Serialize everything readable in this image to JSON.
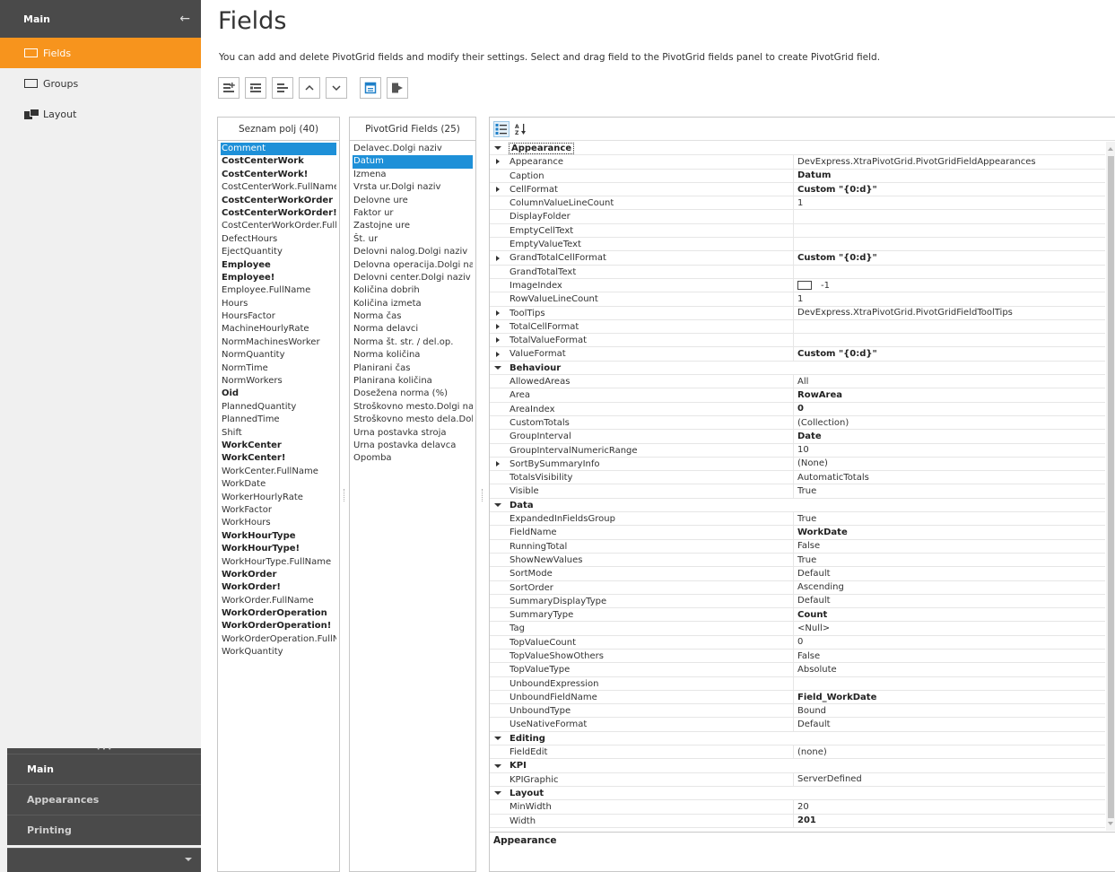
{
  "sidebar": {
    "header": "Main",
    "items": [
      {
        "label": "Fields",
        "active": true
      },
      {
        "label": "Groups",
        "active": false
      },
      {
        "label": "Layout",
        "active": false
      }
    ],
    "groups": [
      "Main",
      "Appearances",
      "Printing"
    ]
  },
  "page": {
    "title": "Fields",
    "description": "You can add and delete PivotGrid fields and modify their settings. Select and drag field to the PivotGrid fields panel to create PivotGrid field."
  },
  "field_list": {
    "header": "Seznam polj (40)",
    "items": [
      {
        "text": "Comment",
        "bold": false,
        "selected": true
      },
      {
        "text": "CostCenterWork",
        "bold": true
      },
      {
        "text": "CostCenterWork!",
        "bold": true
      },
      {
        "text": "CostCenterWork.FullName",
        "bold": false
      },
      {
        "text": "CostCenterWorkOrder",
        "bold": true
      },
      {
        "text": "CostCenterWorkOrder!",
        "bold": true
      },
      {
        "text": "CostCenterWorkOrder.FullNa",
        "bold": false
      },
      {
        "text": "DefectHours",
        "bold": false
      },
      {
        "text": "EjectQuantity",
        "bold": false
      },
      {
        "text": "Employee",
        "bold": true
      },
      {
        "text": "Employee!",
        "bold": true
      },
      {
        "text": "Employee.FullName",
        "bold": false
      },
      {
        "text": "Hours",
        "bold": false
      },
      {
        "text": "HoursFactor",
        "bold": false
      },
      {
        "text": "MachineHourlyRate",
        "bold": false
      },
      {
        "text": "NormMachinesWorker",
        "bold": false
      },
      {
        "text": "NormQuantity",
        "bold": false
      },
      {
        "text": "NormTime",
        "bold": false
      },
      {
        "text": "NormWorkers",
        "bold": false
      },
      {
        "text": "Oid",
        "bold": true
      },
      {
        "text": "PlannedQuantity",
        "bold": false
      },
      {
        "text": "PlannedTime",
        "bold": false
      },
      {
        "text": "Shift",
        "bold": false
      },
      {
        "text": "WorkCenter",
        "bold": true
      },
      {
        "text": "WorkCenter!",
        "bold": true
      },
      {
        "text": "WorkCenter.FullName",
        "bold": false
      },
      {
        "text": "WorkDate",
        "bold": false
      },
      {
        "text": "WorkerHourlyRate",
        "bold": false
      },
      {
        "text": "WorkFactor",
        "bold": false
      },
      {
        "text": "WorkHours",
        "bold": false
      },
      {
        "text": "WorkHourType",
        "bold": true
      },
      {
        "text": "WorkHourType!",
        "bold": true
      },
      {
        "text": "WorkHourType.FullName",
        "bold": false
      },
      {
        "text": "WorkOrder",
        "bold": true
      },
      {
        "text": "WorkOrder!",
        "bold": true
      },
      {
        "text": "WorkOrder.FullName",
        "bold": false
      },
      {
        "text": "WorkOrderOperation",
        "bold": true
      },
      {
        "text": "WorkOrderOperation!",
        "bold": true
      },
      {
        "text": "WorkOrderOperation.FullNam",
        "bold": false
      },
      {
        "text": "WorkQuantity",
        "bold": false
      }
    ]
  },
  "pivot_fields": {
    "header": "PivotGrid Fields (25)",
    "items": [
      {
        "text": "Delavec.Dolgi naziv",
        "selected": false
      },
      {
        "text": "Datum",
        "selected": true
      },
      {
        "text": "Izmena"
      },
      {
        "text": "Vrsta ur.Dolgi naziv"
      },
      {
        "text": "Delovne ure"
      },
      {
        "text": "Faktor ur"
      },
      {
        "text": "Zastojne ure"
      },
      {
        "text": "Št. ur"
      },
      {
        "text": "Delovni nalog.Dolgi naziv"
      },
      {
        "text": "Delovna operacija.Dolgi naziv"
      },
      {
        "text": "Delovni center.Dolgi naziv"
      },
      {
        "text": "Količina dobrih"
      },
      {
        "text": "Količina izmeta"
      },
      {
        "text": "Norma čas"
      },
      {
        "text": "Norma delavci"
      },
      {
        "text": "Norma št. str. / del.op."
      },
      {
        "text": "Norma količina"
      },
      {
        "text": "Planirani čas"
      },
      {
        "text": "Planirana količina"
      },
      {
        "text": "Dosežena norma (%)"
      },
      {
        "text": "Stroškovno mesto.Dolgi naziv"
      },
      {
        "text": "Stroškovno mesto dela.Dolgi na"
      },
      {
        "text": "Urna postavka stroja"
      },
      {
        "text": "Urna postavka delavca"
      },
      {
        "text": "Opomba"
      }
    ]
  },
  "property_grid": {
    "rows": [
      {
        "type": "cat",
        "name": "Appearance",
        "focused": true
      },
      {
        "name": "Appearance",
        "value": "DevExpress.XtraPivotGrid.PivotGridFieldAppearances",
        "expand": true
      },
      {
        "name": "Caption",
        "value": "Datum",
        "bold": true
      },
      {
        "name": "CellFormat",
        "value": "Custom \"{0:d}\"",
        "bold": true,
        "expand": true
      },
      {
        "name": "ColumnValueLineCount",
        "value": "1"
      },
      {
        "name": "DisplayFolder",
        "value": ""
      },
      {
        "name": "EmptyCellText",
        "value": ""
      },
      {
        "name": "EmptyValueText",
        "value": ""
      },
      {
        "name": "GrandTotalCellFormat",
        "value": "Custom \"{0:d}\"",
        "bold": true,
        "expand": true
      },
      {
        "name": "GrandTotalText",
        "value": ""
      },
      {
        "name": "ImageIndex",
        "value": "-1",
        "colorbox": true
      },
      {
        "name": "RowValueLineCount",
        "value": "1"
      },
      {
        "name": "ToolTips",
        "value": "DevExpress.XtraPivotGrid.PivotGridFieldToolTips",
        "expand": true
      },
      {
        "name": "TotalCellFormat",
        "value": "",
        "expand": true
      },
      {
        "name": "TotalValueFormat",
        "value": "",
        "expand": true
      },
      {
        "name": "ValueFormat",
        "value": "Custom \"{0:d}\"",
        "bold": true,
        "expand": true
      },
      {
        "type": "cat",
        "name": "Behaviour"
      },
      {
        "name": "AllowedAreas",
        "value": "All"
      },
      {
        "name": "Area",
        "value": "RowArea",
        "bold": true
      },
      {
        "name": "AreaIndex",
        "value": "0",
        "bold": true
      },
      {
        "name": "CustomTotals",
        "value": "(Collection)"
      },
      {
        "name": "GroupInterval",
        "value": "Date",
        "bold": true
      },
      {
        "name": "GroupIntervalNumericRange",
        "value": "10"
      },
      {
        "name": "SortBySummaryInfo",
        "value": "(None)",
        "expand": true
      },
      {
        "name": "TotalsVisibility",
        "value": "AutomaticTotals"
      },
      {
        "name": "Visible",
        "value": "True"
      },
      {
        "type": "cat",
        "name": "Data"
      },
      {
        "name": "ExpandedInFieldsGroup",
        "value": "True"
      },
      {
        "name": "FieldName",
        "value": "WorkDate",
        "bold": true
      },
      {
        "name": "RunningTotal",
        "value": "False"
      },
      {
        "name": "ShowNewValues",
        "value": "True"
      },
      {
        "name": "SortMode",
        "value": "Default"
      },
      {
        "name": "SortOrder",
        "value": "Ascending"
      },
      {
        "name": "SummaryDisplayType",
        "value": "Default"
      },
      {
        "name": "SummaryType",
        "value": "Count",
        "bold": true
      },
      {
        "name": "Tag",
        "value": "<Null>"
      },
      {
        "name": "TopValueCount",
        "value": "0"
      },
      {
        "name": "TopValueShowOthers",
        "value": "False"
      },
      {
        "name": "TopValueType",
        "value": "Absolute"
      },
      {
        "name": "UnboundExpression",
        "value": ""
      },
      {
        "name": "UnboundFieldName",
        "value": "Field_WorkDate",
        "bold": true
      },
      {
        "name": "UnboundType",
        "value": "Bound"
      },
      {
        "name": "UseNativeFormat",
        "value": "Default"
      },
      {
        "type": "cat",
        "name": "Editing"
      },
      {
        "name": "FieldEdit",
        "value": "(none)"
      },
      {
        "type": "cat",
        "name": "KPI"
      },
      {
        "name": "KPIGraphic",
        "value": "ServerDefined"
      },
      {
        "type": "cat",
        "name": "Layout"
      },
      {
        "name": "MinWidth",
        "value": "20"
      },
      {
        "name": "Width",
        "value": "201",
        "bold": true
      }
    ],
    "description_title": "Appearance"
  },
  "colors": {
    "accent": "#f7941d",
    "selection": "#1e90d8",
    "sidebar_dark": "#4a4a4a",
    "toolbar_blue": "#1e7fc8"
  }
}
